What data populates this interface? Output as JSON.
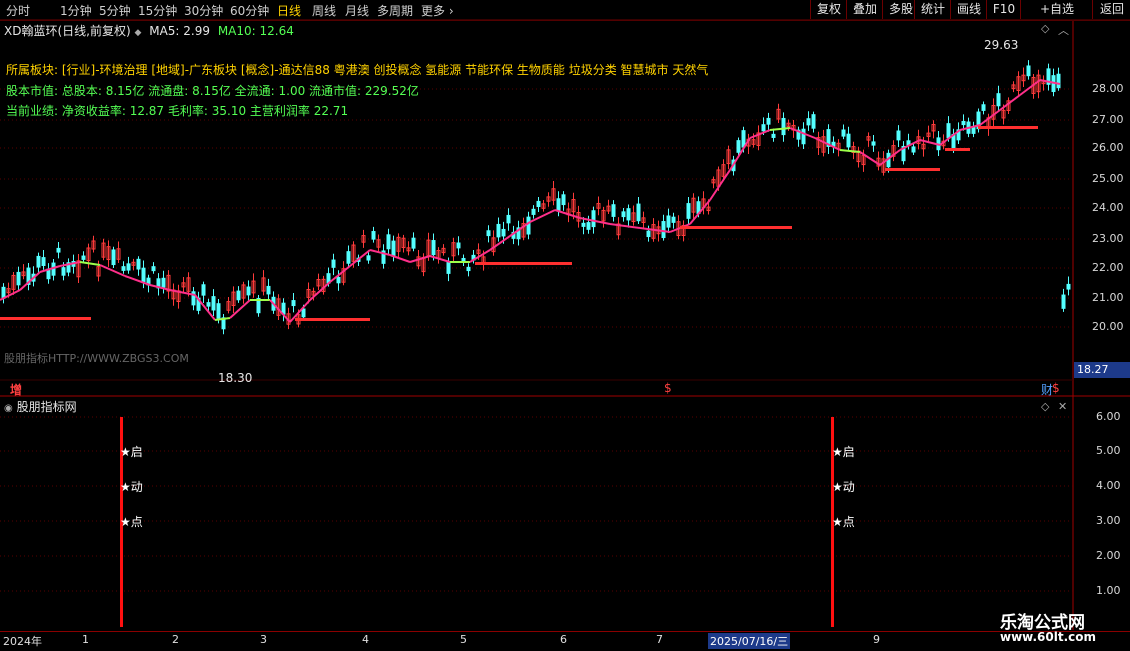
{
  "toolbar": {
    "periods": [
      "分时",
      "1分钟",
      "5分钟",
      "15分钟",
      "30分钟",
      "60分钟",
      "日线",
      "周线",
      "月线",
      "多周期",
      "更多"
    ],
    "active_period": "日线",
    "more_chevron": "›",
    "buttons": [
      "复权",
      "叠加",
      "多股",
      "统计",
      "画线",
      "F10",
      "+自选",
      "返回"
    ]
  },
  "chart": {
    "stock_name": "XD翰蓝环(日线,前复权)",
    "ma5_label": "MA5: 2.99",
    "ma10_label": "MA10: 12.64",
    "info_sector": "所属板块: [行业]-环境治理 [地域]-广东板块 [概念]-通达信88 粤港澳 创投概念 氢能源 节能环保 生物质能 垃圾分类 智慧城市 天然气",
    "info_capital": "股本市值: 总股本: 8.15亿 流通盘: 8.15亿 全流通: 1.00 流通市值: 229.52亿",
    "info_perf": "当前业绩: 净资收益率: 12.87 毛利率: 35.10 主营利润率 22.71",
    "high_label": "29.63",
    "low_label": "18.30",
    "watermark": "股朋指标HTTP://WWW.ZBGS3.COM",
    "current_price": "18.27",
    "price_ticks": [
      "28.00",
      "27.00",
      "26.00",
      "25.00",
      "24.00",
      "23.00",
      "22.00",
      "21.00",
      "20.00"
    ],
    "marker_zeng": "增",
    "marker_s": "$",
    "marker_cai": "财",
    "colors": {
      "up": "#ff3b3b",
      "down": "#54ffff",
      "line_main": "#ff2f8a",
      "line_flat": "#9dff4a",
      "accent": "#ffd200"
    }
  },
  "indicator": {
    "title": "股朋指标网",
    "signal_labels": [
      "★启",
      "★动",
      "★点"
    ],
    "ticks": [
      "6.00",
      "5.00",
      "4.00",
      "3.00",
      "2.00",
      "1.00"
    ]
  },
  "datebar": {
    "labels": [
      "2024年",
      "1",
      "2",
      "3",
      "4",
      "5",
      "6",
      "7",
      "2025/07/16/三",
      "9"
    ]
  },
  "site_watermark": {
    "name": "乐淘公式网",
    "url": "www.60lt.com"
  }
}
